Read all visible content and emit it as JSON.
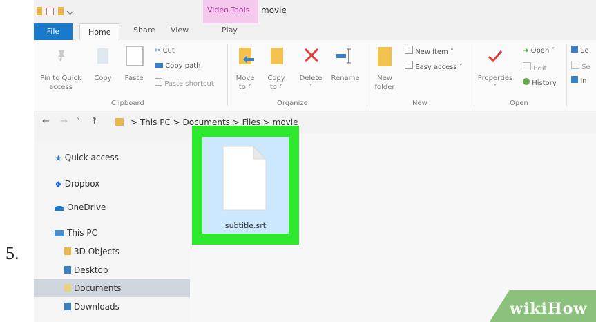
{
  "step": {
    "number": "5."
  },
  "titlebar": {
    "context_tab": "Video Tools",
    "window_title": "movie"
  },
  "tabs": {
    "file": "File",
    "home": "Home",
    "share": "Share",
    "view": "View",
    "play": "Play"
  },
  "ribbon": {
    "clipboard": {
      "pin_line1": "Pin to Quick",
      "pin_line2": "access",
      "copy": "Copy",
      "paste": "Paste",
      "cut": "Cut",
      "copy_path": "Copy path",
      "paste_shortcut": "Paste shortcut",
      "group": "Clipboard"
    },
    "organize": {
      "move_line1": "Move",
      "move_line2": "to ˅",
      "copy_line1": "Copy",
      "copy_line2": "to ˅",
      "delete_line1": "Delete",
      "delete_line2": "˅",
      "rename": "Rename",
      "group": "Organize"
    },
    "new": {
      "folder_line1": "New",
      "folder_line2": "folder",
      "new_item": "New item ˅",
      "easy_access": "Easy access ˅",
      "group": "New"
    },
    "open": {
      "properties_line1": "Properties",
      "properties_line2": "˅",
      "open": "Open ˅",
      "edit": "Edit",
      "history": "History",
      "group": "Open"
    },
    "select": {
      "item1": "Se",
      "item2": "Se",
      "item3": "In"
    }
  },
  "address": {
    "back": "←",
    "forward": "→",
    "recent": "˅",
    "up": "↑",
    "crumbs": "> This PC > Documents > Files > movie"
  },
  "nav": {
    "quick_access": "Quick access",
    "dropbox": "Dropbox",
    "onedrive": "OneDrive",
    "this_pc": "This PC",
    "objects3d": "3D Objects",
    "desktop": "Desktop",
    "documents": "Documents",
    "downloads": "Downloads"
  },
  "file": {
    "name": "subtitle.srt"
  },
  "watermark": {
    "wiki": "wiki",
    "how": "How"
  },
  "colors": {
    "file_tab": "#1979ca",
    "context_tab": "#f5c9ee",
    "highlight": "#2ee82e",
    "selection": "#cce8ff",
    "delete_red": "#e23b3b",
    "watermark": "#8cc07d"
  }
}
